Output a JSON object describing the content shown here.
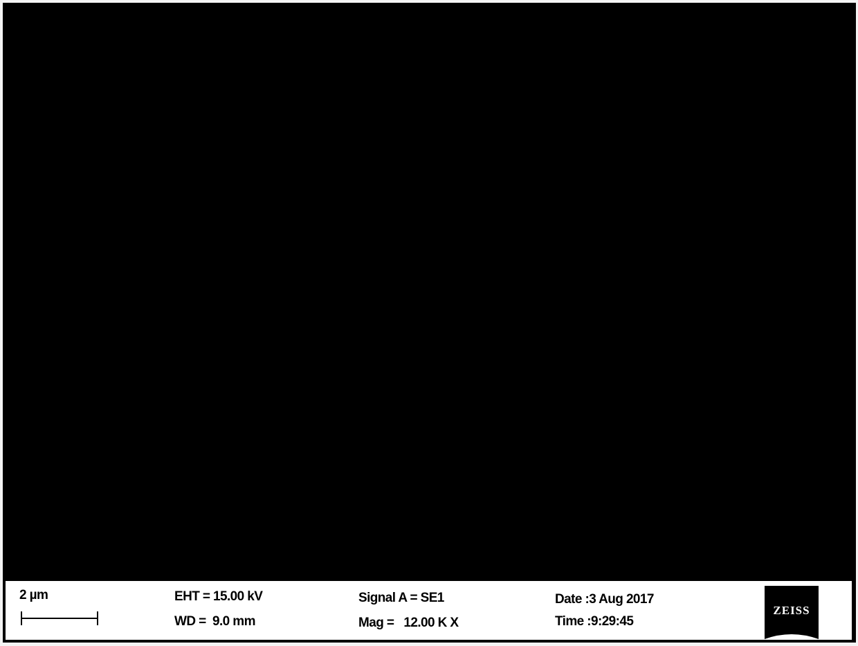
{
  "micrograph": {
    "description": "SEM image area (all black)"
  },
  "info_bar": {
    "scale_label": "2 µm",
    "eht": "EHT = 15.00 kV",
    "wd": "WD =  9.0 mm",
    "signal": "Signal A = SE1",
    "mag": "Mag =   12.00 K X",
    "date": "Date :3 Aug 2017",
    "time": "Time :9:29:45",
    "logo_text": "ZEISS"
  },
  "colors": {
    "background": "#000000",
    "info_bar": "#ffffff",
    "text": "#000000"
  }
}
